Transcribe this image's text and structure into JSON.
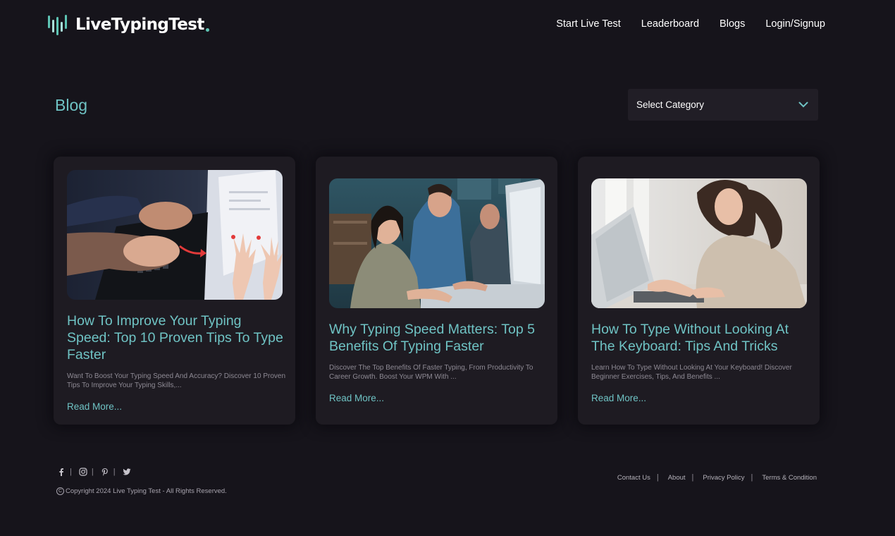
{
  "header": {
    "logo_text": "LiveTypingTest",
    "nav": [
      {
        "label": "Start Live Test"
      },
      {
        "label": "Leaderboard"
      },
      {
        "label": "Blogs"
      },
      {
        "label": "Login/Signup"
      }
    ]
  },
  "page": {
    "title": "Blog",
    "category_select": {
      "selected": "Select Category",
      "icon": "chevron-down-icon"
    }
  },
  "posts": [
    {
      "title": "How To Improve Your Typing Speed: Top 10 Proven Tips To Type Faster",
      "excerpt": "Want To Boost Your Typing Speed And Accuracy? Discover 10 Proven Tips To Improve Your Typing Skills,...",
      "read_more": "Read More..."
    },
    {
      "title": "Why Typing Speed Matters: Top 5 Benefits Of Typing Faster",
      "excerpt": "Discover The Top Benefits Of Faster Typing, From Productivity To Career Growth. Boost Your WPM With ...",
      "read_more": "Read More..."
    },
    {
      "title": "How To Type Without Looking At The Keyboard: Tips And Tricks",
      "excerpt": "Learn How To Type Without Looking At Your Keyboard! Discover Beginner Exercises, Tips, And Benefits ...",
      "read_more": "Read More..."
    }
  ],
  "footer": {
    "social": [
      "facebook-icon",
      "instagram-icon",
      "pinterest-icon",
      "twitter-icon"
    ],
    "social_separator": "|",
    "copyright_symbol": "C",
    "copyright": "Copyright 2024 Live Typing Test - All Rights Reserved.",
    "links": [
      {
        "label": "Contact Us"
      },
      {
        "label": "About"
      },
      {
        "label": "Privacy Policy"
      },
      {
        "label": "Terms & Condition"
      }
    ],
    "links_separator": "|"
  },
  "colors": {
    "background": "#16141b",
    "card": "#1e1b22",
    "accent": "#6fc3c4",
    "logo_accent": "#5ec4b4"
  }
}
